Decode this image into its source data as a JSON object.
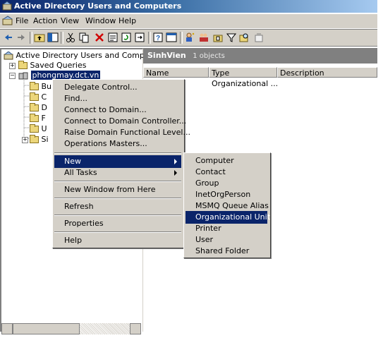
{
  "window": {
    "title": "Active Directory Users and Computers"
  },
  "menubar": [
    {
      "label": "File"
    },
    {
      "label": "Action"
    },
    {
      "label": "View"
    },
    {
      "label": "Window"
    },
    {
      "label": "Help"
    }
  ],
  "toolbar": {
    "icons": [
      "back-icon",
      "forward-icon",
      "up-folder-icon",
      "show-tree-icon",
      "cut-icon",
      "copy-icon",
      "delete-icon",
      "properties-icon",
      "refresh-icon",
      "export-icon",
      "help-icon",
      "console-icon",
      "new-user-icon",
      "new-group-icon",
      "new-ou-icon",
      "filter-icon",
      "find-icon",
      "add-to-group-icon"
    ]
  },
  "tree": {
    "root": "Active Directory Users and Computer",
    "saved_queries": "Saved Queries",
    "domain": "phongmay.dct.vn",
    "children_visible": [
      "Bu",
      "C",
      "D",
      "F",
      "U",
      "Si"
    ]
  },
  "details": {
    "container": "SinhVien",
    "count": "1 objects",
    "columns": [
      "Name",
      "Type",
      "Description"
    ],
    "rows": [
      {
        "type": "Organizational ..."
      }
    ]
  },
  "context_menu": {
    "items": [
      "Delegate Control...",
      "Find...",
      "Connect to Domain...",
      "Connect to Domain Controller...",
      "Raise Domain Functional Level...",
      "Operations Masters...",
      "New",
      "All Tasks",
      "New Window from Here",
      "Refresh",
      "Properties",
      "Help"
    ]
  },
  "submenu": {
    "items": [
      "Computer",
      "Contact",
      "Group",
      "InetOrgPerson",
      "MSMQ Queue Alias",
      "Organizational Unit",
      "Printer",
      "User",
      "Shared Folder"
    ],
    "highlighted": "Organizational Unit"
  }
}
